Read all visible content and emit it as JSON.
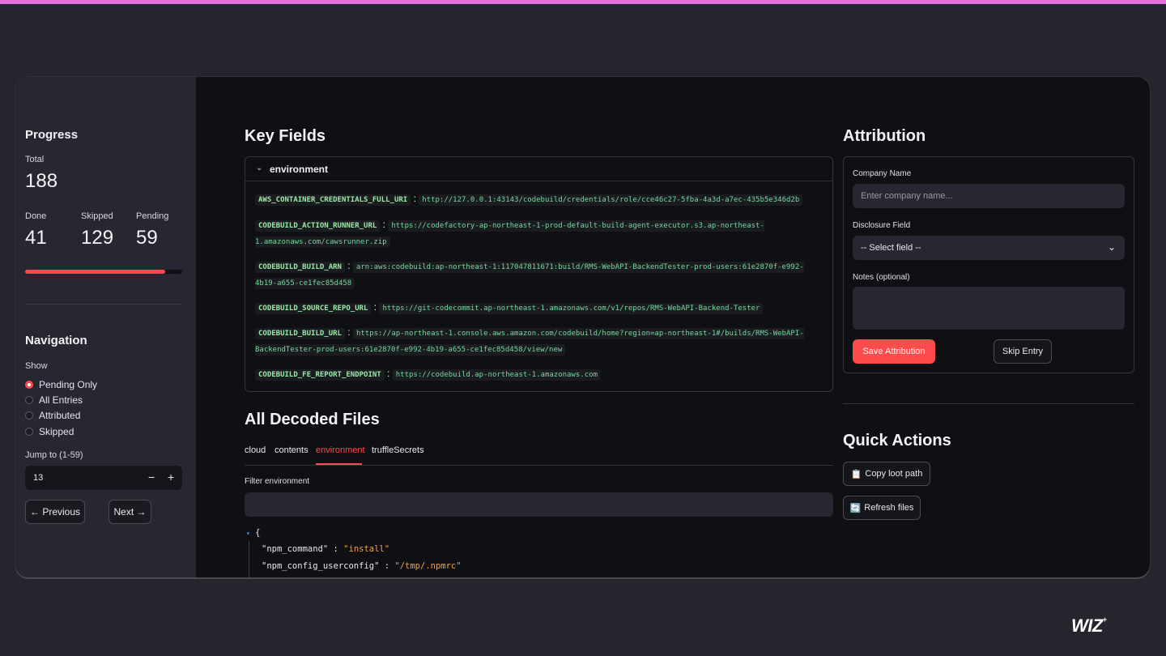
{
  "sidebar": {
    "progress": {
      "heading": "Progress",
      "total_label": "Total",
      "total_value": "188",
      "done_label": "Done",
      "done_value": "41",
      "skipped_label": "Skipped",
      "skipped_value": "129",
      "pending_label": "Pending",
      "pending_value": "59",
      "fraction_complete": 0.89,
      "bar_color": "#f5484f"
    },
    "navigation": {
      "heading": "Navigation",
      "show_label": "Show",
      "options": [
        "Pending Only",
        "All Entries",
        "Attributed",
        "Skipped"
      ],
      "selected": "Pending Only",
      "jump_label": "Jump to (1-59)",
      "jump_value": "13",
      "minus": "−",
      "plus": "+",
      "prev_label": "← Previous",
      "next_label": "Next →"
    }
  },
  "key_fields": {
    "heading": "Key Fields",
    "expander_title": "environment",
    "entries": [
      {
        "key": "AWS_CONTAINER_CREDENTIALS_FULL_URI",
        "value": "http://127.0.0.1:43143/codebuild/credentials/role/cce46c27-5fba-4a3d-a7ec-435b5e346d2b"
      },
      {
        "key": "CODEBUILD_ACTION_RUNNER_URL",
        "value": "https://codefactory-ap-northeast-1-prod-default-build-agent-executor.s3.ap-northeast-1.amazonaws.com/cawsrunner.zip"
      },
      {
        "key": "CODEBUILD_BUILD_ARN",
        "value": "arn:aws:codebuild:ap-northeast-1:117047811671:build/RMS-WebAPI-BackendTester-prod-users:61e2870f-e992-4b19-a655-ce1fec85d458"
      },
      {
        "key": "CODEBUILD_SOURCE_REPO_URL",
        "value": "https://git-codecommit.ap-northeast-1.amazonaws.com/v1/repos/RMS-WebAPI-Backend-Tester"
      },
      {
        "key": "CODEBUILD_BUILD_URL",
        "value": "https://ap-northeast-1.console.aws.amazon.com/codebuild/home?region=ap-northeast-1#/builds/RMS-WebAPI-BackendTester-prod-users:61e2870f-e992-4b19-a655-ce1fec85d458/view/new"
      },
      {
        "key": "CODEBUILD_FE_REPORT_ENDPOINT",
        "value": "https://codebuild.ap-northeast-1.amazonaws.com"
      }
    ]
  },
  "decoded_files": {
    "heading": "All Decoded Files",
    "tabs": [
      "cloud",
      "contents",
      "environment",
      "truffleSecrets"
    ],
    "active_tab": "environment",
    "filter_label": "Filter environment",
    "json_open": "{",
    "json_lines": [
      {
        "key": "\"npm_command\"",
        "value": "\"install\""
      },
      {
        "key": "\"npm_config_userconfig\"",
        "value": "\"/tmp/.npmrc\""
      }
    ]
  },
  "attribution": {
    "heading": "Attribution",
    "company_label": "Company Name",
    "company_placeholder": "Enter company name...",
    "disclosure_label": "Disclosure Field",
    "disclosure_value": "-- Select field --",
    "notes_label": "Notes (optional)",
    "save_label": "Save Attribution",
    "skip_label": "Skip Entry"
  },
  "quick_actions": {
    "heading": "Quick Actions",
    "copy_label": "Copy loot path",
    "refresh_label": "Refresh files"
  },
  "branding": {
    "logo_text": "WIZ",
    "logo_mark": "+"
  },
  "colors": {
    "accent": "#ff4b4b",
    "top_bar": "#e86fe0",
    "key_text": "#9be9a8",
    "json_string": "#f6a04d"
  }
}
